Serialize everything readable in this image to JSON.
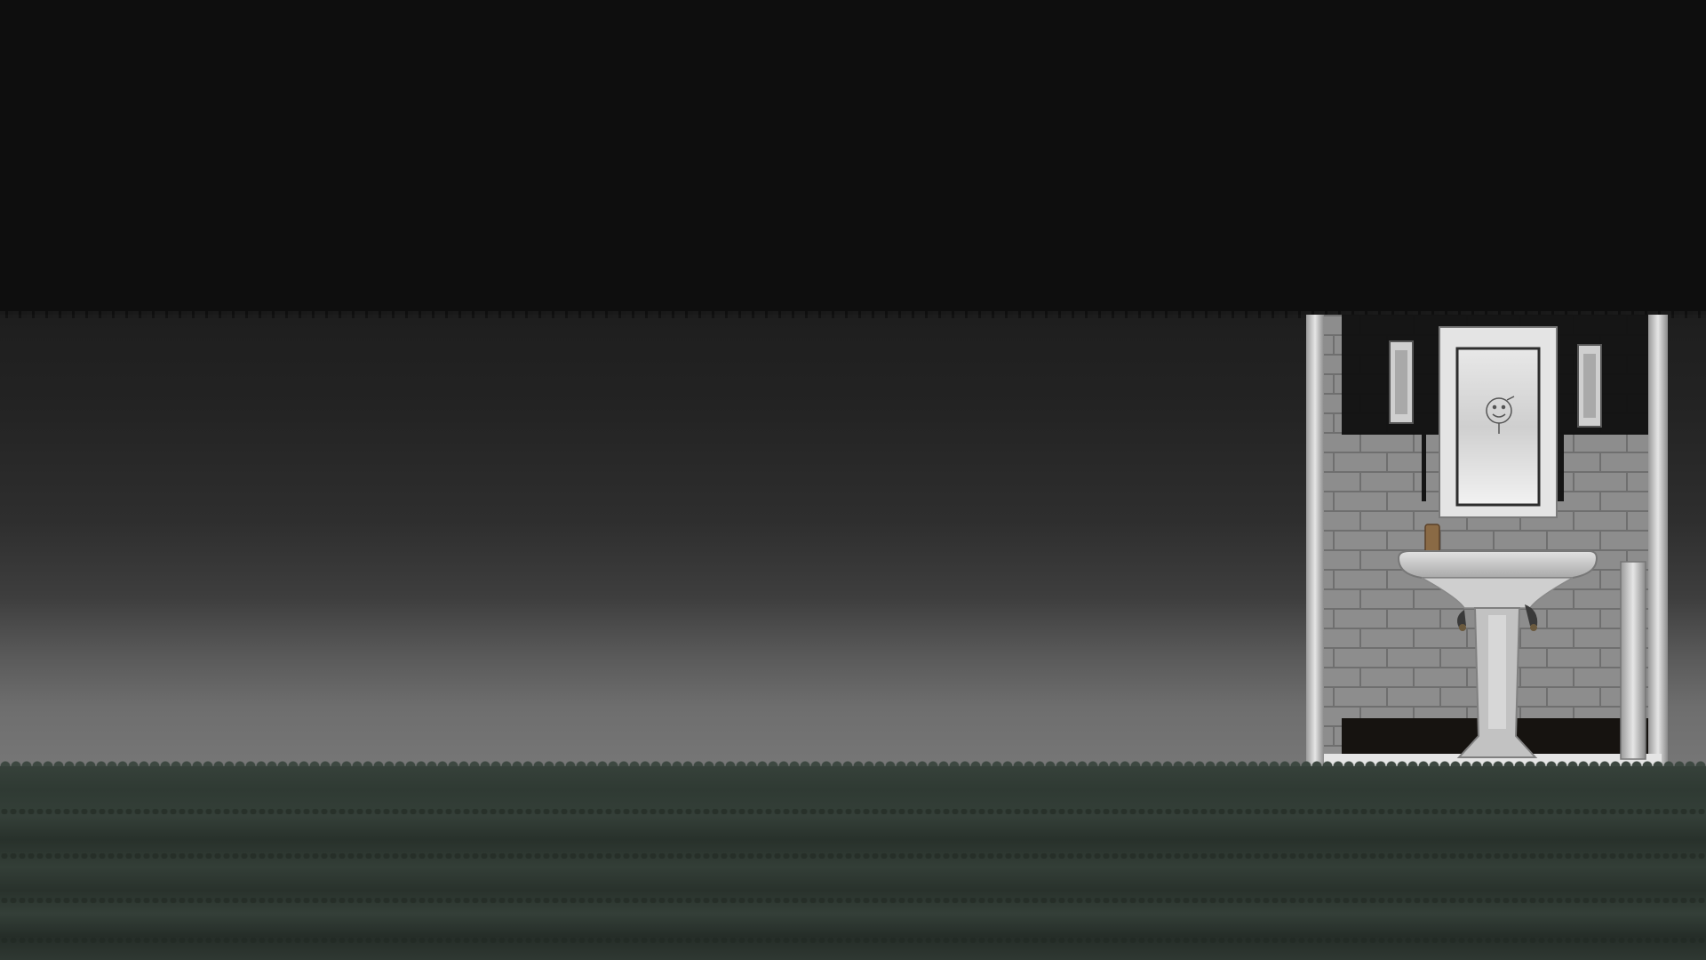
{
  "scene": {
    "type": "side-view game scene",
    "colors": {
      "sky": "#0e0e0e",
      "fog_top": "#1e1e1e",
      "fog_bottom": "#777777",
      "ground": "#2f3a33",
      "tile": "#8a8a8a",
      "grout": "#6f6f6f"
    },
    "objects": [
      "bathroom-wall",
      "mirror",
      "smiley-face-drawing",
      "wall-lamp-left",
      "wall-lamp-right",
      "pedestal-sink",
      "soap-bottle",
      "faucet-handles",
      "pipe"
    ]
  }
}
